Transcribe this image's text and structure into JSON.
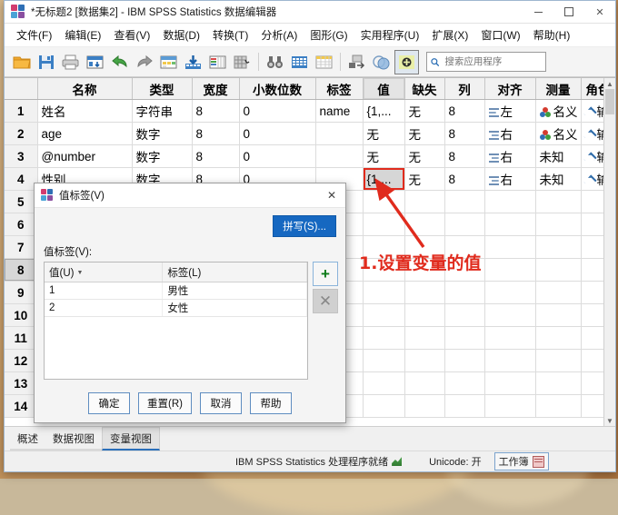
{
  "window": {
    "title": "*无标题2 [数据集2] - IBM SPSS Statistics 数据编辑器",
    "app_icon": "spss-icon",
    "minimize": "−",
    "maximize": "□",
    "close": "✕"
  },
  "menubar": [
    {
      "label": "文件(F)",
      "name": "menu-file"
    },
    {
      "label": "编辑(E)",
      "name": "menu-edit"
    },
    {
      "label": "查看(V)",
      "name": "menu-view"
    },
    {
      "label": "数据(D)",
      "name": "menu-data"
    },
    {
      "label": "转换(T)",
      "name": "menu-transform"
    },
    {
      "label": "分析(A)",
      "name": "menu-analyze"
    },
    {
      "label": "图形(G)",
      "name": "menu-graphs"
    },
    {
      "label": "实用程序(U)",
      "name": "menu-utilities"
    },
    {
      "label": "扩展(X)",
      "name": "menu-extensions"
    },
    {
      "label": "窗口(W)",
      "name": "menu-window"
    },
    {
      "label": "帮助(H)",
      "name": "menu-help"
    }
  ],
  "toolbar": {
    "buttons": [
      {
        "icon": "open-folder-icon",
        "name": "open-file-button"
      },
      {
        "icon": "save-disk-icon",
        "name": "save-button"
      },
      {
        "icon": "print-icon",
        "name": "print-button"
      },
      {
        "icon": "recall-dialog-icon",
        "name": "recall-dialogs-button"
      },
      {
        "icon": "undo-arrow-icon",
        "name": "undo-button"
      },
      {
        "icon": "redo-arrow-icon",
        "name": "redo-button"
      },
      {
        "icon": "goto-case-icon",
        "name": "goto-case-button"
      },
      {
        "icon": "goto-variable-icon",
        "name": "goto-variable-button"
      },
      {
        "icon": "variables-icon",
        "name": "variables-button"
      },
      {
        "icon": "run-descriptives-icon",
        "name": "descriptives-button"
      },
      {
        "icon": "find-binoculars-icon",
        "name": "find-button"
      },
      {
        "icon": "insert-case-icon",
        "name": "insert-case-button"
      },
      {
        "icon": "insert-variable-icon",
        "name": "insert-variable-button"
      },
      {
        "icon": "split-file-icon",
        "name": "split-file-button"
      },
      {
        "icon": "weight-cases-icon",
        "name": "weight-cases-button"
      },
      {
        "icon": "select-cases-icon",
        "name": "select-cases-button"
      },
      {
        "icon": "value-labels-toggle-icon",
        "name": "value-labels-toggle-button"
      }
    ],
    "search_placeholder": "搜索应用程序",
    "search_value": "",
    "search_icon": "search-icon"
  },
  "grid": {
    "columns": [
      "名称",
      "类型",
      "宽度",
      "小数位数",
      "标签",
      "值",
      "缺失",
      "列",
      "对齐",
      "测量",
      "角色"
    ],
    "rows": [
      {
        "n": "1",
        "name": "姓名",
        "type": "字符串",
        "width": "8",
        "decimals": "0",
        "label": "name",
        "values": "{1,...",
        "missing": "无",
        "columns": "8",
        "align": "左",
        "measure": "名义",
        "role": "输"
      },
      {
        "n": "2",
        "name": "age",
        "type": "数字",
        "width": "8",
        "decimals": "0",
        "label": "",
        "values": "无",
        "missing": "无",
        "columns": "8",
        "align": "右",
        "measure": "名义",
        "role": "输"
      },
      {
        "n": "3",
        "name": "@number",
        "type": "数字",
        "width": "8",
        "decimals": "0",
        "label": "",
        "values": "无",
        "missing": "无",
        "columns": "8",
        "align": "右",
        "measure": "未知",
        "role": "输"
      },
      {
        "n": "4",
        "name": "性别",
        "type": "数字",
        "width": "8",
        "decimals": "0",
        "label": "",
        "values": "{1,...",
        "missing": "无",
        "columns": "8",
        "align": "右",
        "measure": "未知",
        "role": "输"
      },
      {
        "n": "5",
        "name": "",
        "type": "",
        "width": "",
        "decimals": "",
        "label": "",
        "values": "",
        "missing": "",
        "columns": "",
        "align": "",
        "measure": "",
        "role": ""
      },
      {
        "n": "6",
        "name": "",
        "type": "",
        "width": "",
        "decimals": "",
        "label": "",
        "values": "",
        "missing": "",
        "columns": "",
        "align": "",
        "measure": "",
        "role": ""
      },
      {
        "n": "7",
        "name": "",
        "type": "",
        "width": "",
        "decimals": "",
        "label": "",
        "values": "",
        "missing": "",
        "columns": "",
        "align": "",
        "measure": "",
        "role": ""
      },
      {
        "n": "8",
        "name": "",
        "type": "",
        "width": "",
        "decimals": "",
        "label": "",
        "values": "",
        "missing": "",
        "columns": "",
        "align": "",
        "measure": "",
        "role": ""
      },
      {
        "n": "9",
        "name": "",
        "type": "",
        "width": "",
        "decimals": "",
        "label": "",
        "values": "",
        "missing": "",
        "columns": "",
        "align": "",
        "measure": "",
        "role": ""
      },
      {
        "n": "10",
        "name": "",
        "type": "",
        "width": "",
        "decimals": "",
        "label": "",
        "values": "",
        "missing": "",
        "columns": "",
        "align": "",
        "measure": "",
        "role": ""
      },
      {
        "n": "11",
        "name": "",
        "type": "",
        "width": "",
        "decimals": "",
        "label": "",
        "values": "",
        "missing": "",
        "columns": "",
        "align": "",
        "measure": "",
        "role": ""
      },
      {
        "n": "12",
        "name": "",
        "type": "",
        "width": "",
        "decimals": "",
        "label": "",
        "values": "",
        "missing": "",
        "columns": "",
        "align": "",
        "measure": "",
        "role": ""
      },
      {
        "n": "13",
        "name": "",
        "type": "",
        "width": "",
        "decimals": "",
        "label": "",
        "values": "",
        "missing": "",
        "columns": "",
        "align": "",
        "measure": "",
        "role": ""
      },
      {
        "n": "14",
        "name": "",
        "type": "",
        "width": "",
        "decimals": "",
        "label": "",
        "values": "",
        "missing": "",
        "columns": "",
        "align": "",
        "measure": "",
        "role": ""
      }
    ],
    "selected_row": "8",
    "selected_cell": {
      "row": "4",
      "column": "值",
      "value": "{1,...",
      "highlight_color": "#e02b1d"
    }
  },
  "dialog": {
    "title": "值标签(V)",
    "icon": "spss-icon",
    "close_icon": "✕",
    "spell_button": "拼写(S)...",
    "section_label": "值标签(V):",
    "table": {
      "headers": [
        "值(U)",
        "标签(L)"
      ],
      "sort_caret": "▼",
      "rows": [
        {
          "value": "1",
          "label": "男性"
        },
        {
          "value": "2",
          "label": "女性"
        }
      ]
    },
    "add_button": "+",
    "delete_button": "✕",
    "footer_buttons": [
      {
        "label": "确定",
        "name": "ok-button"
      },
      {
        "label": "重置(R)",
        "name": "reset-button"
      },
      {
        "label": "取消",
        "name": "cancel-button"
      },
      {
        "label": "帮助",
        "name": "help-button"
      }
    ]
  },
  "view_tabs": [
    {
      "label": "概述",
      "name": "tab-overview",
      "active": false
    },
    {
      "label": "数据视图",
      "name": "tab-data-view",
      "active": false
    },
    {
      "label": "变量视图",
      "name": "tab-variable-view",
      "active": true
    }
  ],
  "statusbar": {
    "processor": "IBM SPSS Statistics 处理程序就绪",
    "unicode": "Unicode: 开",
    "workbook": "工作簿"
  },
  "annotation": {
    "text": "1.设置变量的值",
    "color": "#e02b1d",
    "arrow": "arrow-pointing-to-value-cell"
  }
}
